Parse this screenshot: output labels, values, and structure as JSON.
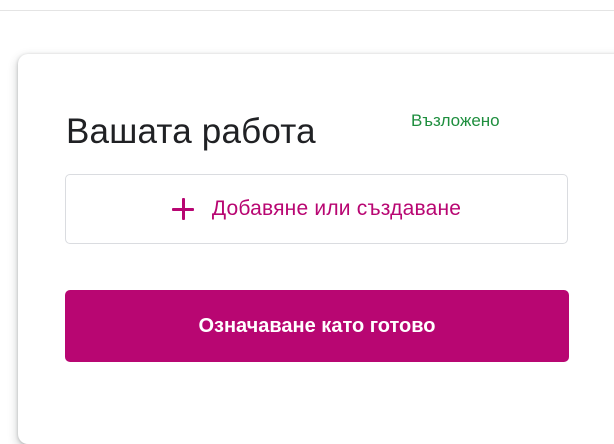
{
  "card": {
    "title": "Вашата работа",
    "status": "Възложено",
    "add_button_label": "Добавяне или създаване",
    "done_button_label": "Означаване като готово"
  },
  "colors": {
    "accent": "#b80672",
    "status": "#1e8e3e",
    "title": "#202124"
  },
  "icons": {
    "add": "plus-icon"
  }
}
